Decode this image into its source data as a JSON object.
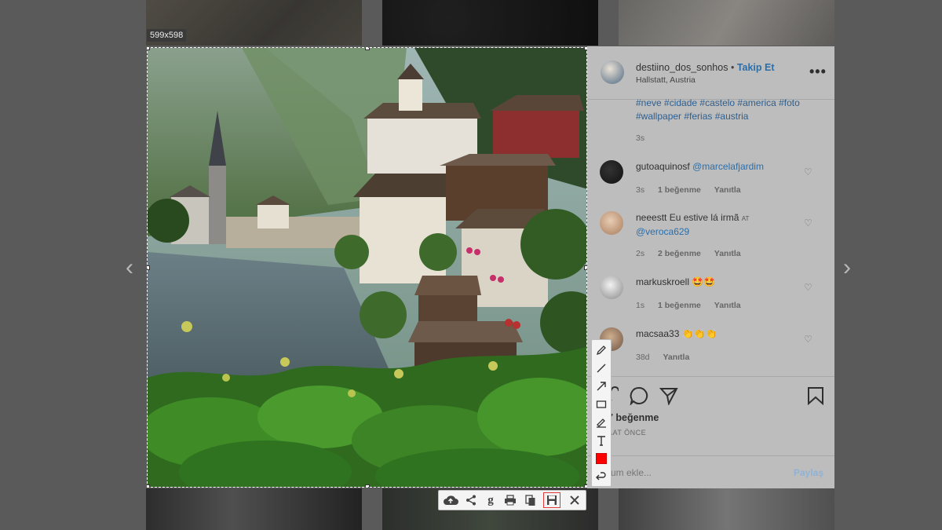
{
  "selection": {
    "size_label": "599x598"
  },
  "post": {
    "username": "destiino_dos_sonhos",
    "separator": "•",
    "follow_label": "Takip Et",
    "location": "Hallstatt, Austria",
    "caption_tags": "#neve #cidade #castelo #america #foto #wallpaper #ferias #austria",
    "caption_time": "3s",
    "comments": [
      {
        "user": "gutoaquinosf",
        "text": "@marcelafjardim",
        "time": "3s",
        "likes": "1 beğenme",
        "reply": "Yanıtla"
      },
      {
        "user": "neeestt",
        "text": "Eu estive lá irmã",
        "text_tail": "@veroca629",
        "time": "2s",
        "likes": "2 beğenme",
        "reply": "Yanıtla"
      },
      {
        "user": "markuskroell",
        "text": "🤩🤩",
        "time": "1s",
        "likes": "1 beğenme",
        "reply": "Yanıtla"
      },
      {
        "user": "macsaa33",
        "text": "👏👏👏",
        "time": "38d",
        "likes": "",
        "reply": "Yanıtla"
      }
    ],
    "likes_count": "7 beğenme",
    "post_time": "AAT ÖNCE",
    "comment_placeholder": "rum ekle...",
    "share_label": "Paylaş"
  },
  "toolbar_colors": {
    "draw_color": "#ff0000",
    "active_outline": "#e23a3a"
  },
  "icons": {
    "draw": [
      "pencil-icon",
      "line-icon",
      "arrow-icon",
      "rectangle-icon",
      "marker-icon",
      "text-icon",
      "color-swatch",
      "undo-icon"
    ],
    "actions": [
      "cloud-upload-icon",
      "share-icon",
      "google-icon",
      "print-icon",
      "copy-icon",
      "save-icon",
      "close-icon"
    ]
  }
}
